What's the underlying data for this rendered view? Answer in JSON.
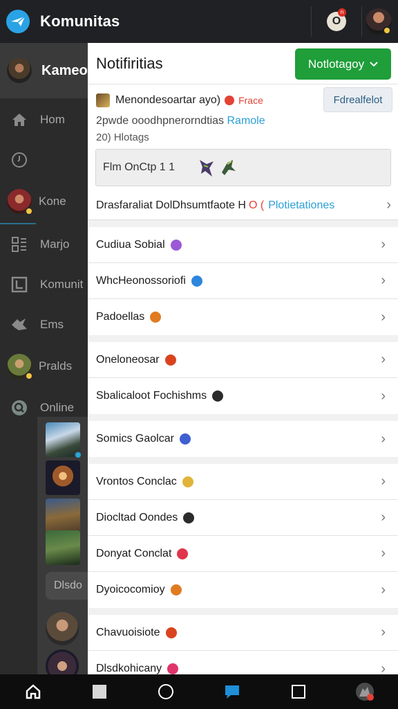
{
  "app": {
    "title": "Komunitas",
    "bell_label": "O",
    "bell_badge": "n"
  },
  "sidebar": {
    "profile_name": "Kameo",
    "items": [
      {
        "label": "Hom"
      },
      {
        "label": ""
      },
      {
        "label": "Kone"
      },
      {
        "label": "Marjo"
      },
      {
        "label": "Komunit"
      },
      {
        "label": "Ems"
      },
      {
        "label": "Pralds"
      },
      {
        "label": "Online"
      }
    ],
    "chip_label": "Dlsdo"
  },
  "panel": {
    "title": "Notifiritias",
    "action_button": "Notlotagoy",
    "notification": {
      "name": "Menondesoartar ayo)",
      "tag": "Frace",
      "action": "Fdrealfelot",
      "line2_text": "2pwde ooodhpnerorndtias",
      "line2_link": "Ramole",
      "line3": "20) Hlotags",
      "preview_text": "Flm OnCtp  1     1",
      "footer_text": "Drasfaraliat DolDhsumtfaote H",
      "footer_red": "O (",
      "footer_link": "Plotietationes"
    },
    "groups": [
      [
        {
          "label": "Cudiua Sobial",
          "dot_color": "#9b59d6"
        },
        {
          "label": "WhcHeonossoriofi",
          "dot_color": "#2e86de"
        },
        {
          "label": "Padoellas",
          "dot_color": "#e07b22"
        }
      ],
      [
        {
          "label": "Oneloneosar",
          "dot_color": "#d9441f"
        },
        {
          "label": "Sbalicaloot Fochishms",
          "dot_color": "#2b2b2b"
        }
      ],
      [
        {
          "label": "Somics Gaolcar",
          "dot_color": "#3f5fd1"
        }
      ],
      [
        {
          "label": "Vrontos Conclac",
          "dot_color": "#e0b43a"
        },
        {
          "label": "Diocltad Oondes",
          "dot_color": "#2b2b2b"
        },
        {
          "label": "Donyat Conclat",
          "dot_color": "#e0354a"
        },
        {
          "label": "Dyoicocomioy",
          "dot_color": "#e07b22"
        }
      ],
      [
        {
          "label": "Chavuoisiote",
          "dot_color": "#d9441f"
        },
        {
          "label": "Dlsdkohicany",
          "dot_color": "#e0356a"
        }
      ]
    ]
  },
  "colors": {
    "accent": "#1f9e3a",
    "link": "#2a9fd6",
    "logo": "#2aa3e6"
  }
}
